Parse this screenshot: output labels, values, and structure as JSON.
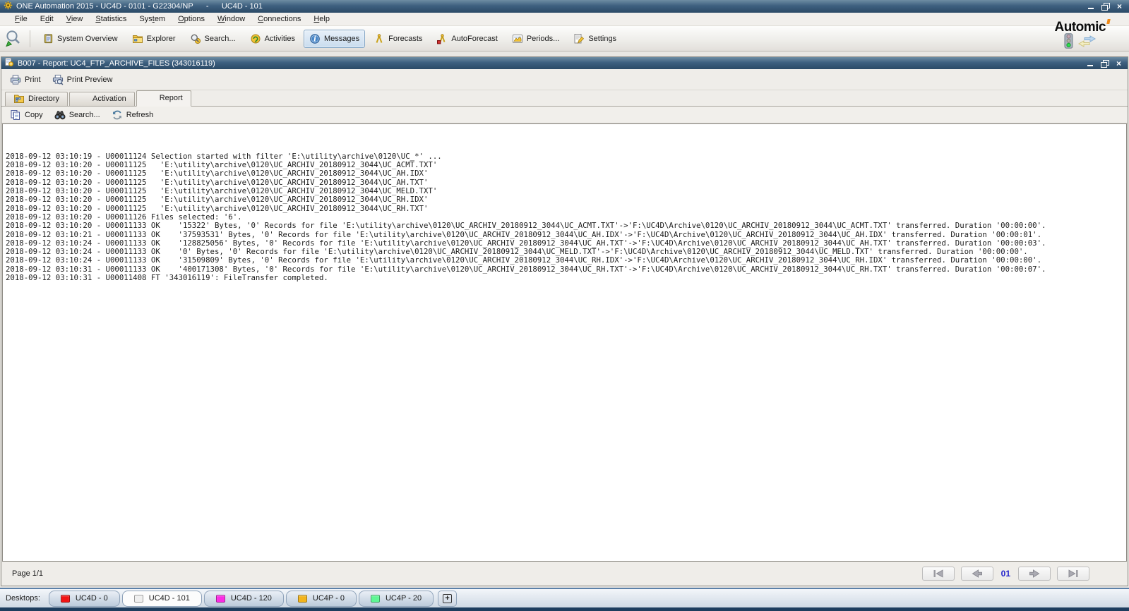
{
  "titlebar": {
    "app_title": "ONE Automation 2015 - UC4D - 0101 - G22304/NP      -      UC4D - 101",
    "window_controls": [
      "minimize",
      "restore",
      "close"
    ]
  },
  "menubar": {
    "items": [
      {
        "label": "File",
        "underline": 0
      },
      {
        "label": "Edit",
        "underline": 1
      },
      {
        "label": "View",
        "underline": 0
      },
      {
        "label": "Statistics",
        "underline": 0
      },
      {
        "label": "System",
        "underline": 3
      },
      {
        "label": "Options",
        "underline": 0
      },
      {
        "label": "Window",
        "underline": 0
      },
      {
        "label": "Connections",
        "underline": 0
      },
      {
        "label": "Help",
        "underline": 0
      }
    ]
  },
  "toolbar": {
    "buttons": [
      {
        "label": "System Overview",
        "icon": "system-overview-icon"
      },
      {
        "label": "Explorer",
        "icon": "explorer-icon"
      },
      {
        "label": "Search...",
        "icon": "search-icon"
      },
      {
        "label": "Activities",
        "icon": "activities-icon"
      },
      {
        "label": "Messages",
        "icon": "messages-icon",
        "active": true
      },
      {
        "label": "Forecasts",
        "icon": "forecasts-icon"
      },
      {
        "label": "AutoForecast",
        "icon": "autoforecast-icon"
      },
      {
        "label": "Periods...",
        "icon": "periods-icon"
      },
      {
        "label": "Settings",
        "icon": "settings-icon"
      }
    ],
    "brand": "Automic"
  },
  "report_window": {
    "title": "B007 - Report: UC4_FTP_ARCHIVE_FILES (343016119)",
    "print_toolbar": [
      {
        "label": "Print",
        "icon": "print-icon"
      },
      {
        "label": "Print Preview",
        "icon": "print-preview-icon"
      }
    ],
    "tabs": [
      {
        "label": "Directory",
        "icon": "directory-icon"
      },
      {
        "label": "Activation"
      },
      {
        "label": "Report",
        "active": true
      }
    ],
    "report_toolbar": [
      {
        "label": "Copy",
        "icon": "copy-icon"
      },
      {
        "label": "Search...",
        "icon": "binoculars-icon"
      },
      {
        "label": "Refresh",
        "icon": "refresh-icon"
      }
    ],
    "log_lines": [
      "2018-09-12 03:10:19 - U00011124 Selection started with filter 'E:\\utility\\archive\\0120\\UC_*' ...",
      "2018-09-12 03:10:20 - U00011125   'E:\\utility\\archive\\0120\\UC_ARCHIV_20180912_3044\\UC_ACMT.TXT'",
      "2018-09-12 03:10:20 - U00011125   'E:\\utility\\archive\\0120\\UC_ARCHIV_20180912_3044\\UC_AH.IDX'",
      "2018-09-12 03:10:20 - U00011125   'E:\\utility\\archive\\0120\\UC_ARCHIV_20180912_3044\\UC_AH.TXT'",
      "2018-09-12 03:10:20 - U00011125   'E:\\utility\\archive\\0120\\UC_ARCHIV_20180912_3044\\UC_MELD.TXT'",
      "2018-09-12 03:10:20 - U00011125   'E:\\utility\\archive\\0120\\UC_ARCHIV_20180912_3044\\UC_RH.IDX'",
      "2018-09-12 03:10:20 - U00011125   'E:\\utility\\archive\\0120\\UC_ARCHIV_20180912_3044\\UC_RH.TXT'",
      "2018-09-12 03:10:20 - U00011126 Files selected: '6'.",
      "2018-09-12 03:10:20 - U00011133 OK    '15322' Bytes, '0' Records for file 'E:\\utility\\archive\\0120\\UC_ARCHIV_20180912_3044\\UC_ACMT.TXT'->'F:\\UC4D\\Archive\\0120\\UC_ARCHIV_20180912_3044\\UC_ACMT.TXT' transferred. Duration '00:00:00'.",
      "2018-09-12 03:10:21 - U00011133 OK    '37593531' Bytes, '0' Records for file 'E:\\utility\\archive\\0120\\UC_ARCHIV_20180912_3044\\UC_AH.IDX'->'F:\\UC4D\\Archive\\0120\\UC_ARCHIV_20180912_3044\\UC_AH.IDX' transferred. Duration '00:00:01'.",
      "2018-09-12 03:10:24 - U00011133 OK    '128825056' Bytes, '0' Records for file 'E:\\utility\\archive\\0120\\UC_ARCHIV_20180912_3044\\UC_AH.TXT'->'F:\\UC4D\\Archive\\0120\\UC_ARCHIV_20180912_3044\\UC_AH.TXT' transferred. Duration '00:00:03'.",
      "2018-09-12 03:10:24 - U00011133 OK    '0' Bytes, '0' Records for file 'E:\\utility\\archive\\0120\\UC_ARCHIV_20180912_3044\\UC_MELD.TXT'->'F:\\UC4D\\Archive\\0120\\UC_ARCHIV_20180912_3044\\UC_MELD.TXT' transferred. Duration '00:00:00'.",
      "2018-09-12 03:10:24 - U00011133 OK    '31509809' Bytes, '0' Records for file 'E:\\utility\\archive\\0120\\UC_ARCHIV_20180912_3044\\UC_RH.IDX'->'F:\\UC4D\\Archive\\0120\\UC_ARCHIV_20180912_3044\\UC_RH.IDX' transferred. Duration '00:00:00'.",
      "2018-09-12 03:10:31 - U00011133 OK    '400171308' Bytes, '0' Records for file 'E:\\utility\\archive\\0120\\UC_ARCHIV_20180912_3044\\UC_RH.TXT'->'F:\\UC4D\\Archive\\0120\\UC_ARCHIV_20180912_3044\\UC_RH.TXT' transferred. Duration '00:00:07'.",
      "2018-09-12 03:10:31 - U00011408 FT '343016119': FileTransfer completed."
    ],
    "page_label": "Page 1/1",
    "pagination": {
      "current_page": "01",
      "buttons": [
        "first-page",
        "previous-page",
        "next-page",
        "last-page"
      ]
    }
  },
  "desktops_bar": {
    "label": "Desktops:",
    "tabs": [
      {
        "label": "UC4D - 0",
        "color": "#f21414"
      },
      {
        "label": "UC4D - 101",
        "color": "#efefef",
        "active": true
      },
      {
        "label": "UC4D - 120",
        "color": "#fb2ce4"
      },
      {
        "label": "UC4P - 0",
        "color": "#f2b41c"
      },
      {
        "label": "UC4P - 20",
        "color": "#5ef794"
      }
    ]
  },
  "colors": {
    "titlebar_blue": "#3e6080",
    "selected_button_fill": "#c9dcee",
    "selected_button_border": "#84a6c6",
    "page_number_blue": "#2222cc",
    "desktop_strip_navy": "#1d3d5e",
    "brand_tick_orange": "#f08a18"
  }
}
